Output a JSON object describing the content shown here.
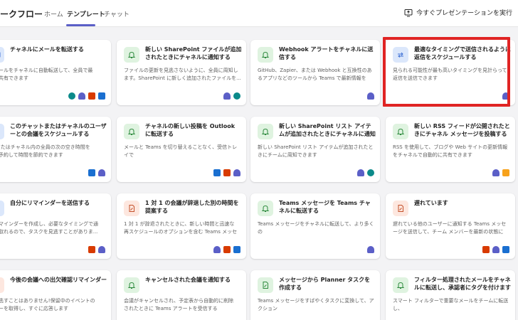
{
  "header": {
    "title": "ークフロー",
    "tabs": [
      {
        "label": "ホーム"
      },
      {
        "label": "テンプレート"
      },
      {
        "label": "チャット"
      }
    ],
    "present_label": "今すぐプレゼンテーションを実行"
  },
  "cards": [
    {
      "title": "チャネルにメールを転送する",
      "desc": "なメールをチャネルに自動転送して、全員で最\n報を共有できます"
    },
    {
      "title": "新しい SharePoint ファイルが追加されたときにチャネルに通知する",
      "desc": "ファイルの更新を見逃さないように、全員に周知し\nます。SharePoint に新しく追加されたファイルを..."
    },
    {
      "title": "Webhook アラートをチャネルに送信する",
      "desc": "GitHub、Zapier、または Webhook と互換性のあ\nるアプリなどのツールから Teams で最新情報を取..."
    },
    {
      "title": "最適なタイミングで送信されるように返信をスケジュールする",
      "desc": "見られる可能性が最も高いタイミングを見計らって\n返信を送信できます"
    },
    {
      "title": "このチャットまたはチャネルのユーザーとの会議をスケジュールする",
      "desc": "ま!またはチャネル内の全員の次の空き時間を\n的に予約して時間を節約できます"
    },
    {
      "title": "チャネルの新しい投稿を Outlook に転送する",
      "desc": "メールと Teams を切り替えることなく、受信トレイで\n重要なチャネル投稿を確認できます"
    },
    {
      "title": "新しい SharePoint リスト アイテムが追加されたときにチャネルに通知する",
      "desc": "新しい SharePoint リスト アイテムが追加されたと\nきにチームに周知できます"
    },
    {
      "title": "新しい RSS フィードが公開されたときにチャネル メッセージを投稿する",
      "desc": "RSS を使用して、ブログや Web サイトの更新情報\nをチャネルで自動的に共有できます"
    },
    {
      "title": "自分にリマインダーを送信する",
      "desc": "なリマインダーを作成し、必要なタイミングで通\n受け取れるので、タスクを見逃すことがありま..."
    },
    {
      "title": "1 対 1 の会議が辞退した別の時間を提案する",
      "desc": "1 対 1 が辞退されたときに、新しい時間と迅速な\n再スケジュールのオプションを含む Teams メッセー..."
    },
    {
      "title": "Teams メッセージを Teams チャネルに転送する",
      "desc": "Teams メッセージをチャネルに転送して、より多くの\nユーザーと共有します"
    },
    {
      "title": "遅れています",
      "desc": "遅れている他のユーザーに通知する Teams メッセ\nージを送信して、チーム メンバーを最新の状態に保..."
    },
    {
      "title": "今後の会議への出欠確認リマインダー",
      "desc": "を見逃すことはありません!保留中のイベントの\nンダーを取得し、すぐに応答します"
    },
    {
      "title": "キャンセルされた会議を通知する",
      "desc": "会議がキャンセルされ、予定表から自動的に削除\nされたときに Teams アラートを受信する"
    },
    {
      "title": "メッセージから Planner タスクを作成する",
      "desc": "Teams メッセージをすばやくタスクに変換して、アクション\nアイテムを常に把握できます"
    },
    {
      "title": "フィルター処理されたメールをチャネルに転送し、承認者にタグを付けます",
      "desc": "スマート フィルターで重要なメールをチームに転送し、\nチャネル送信で承認者をタグ付けできます"
    }
  ],
  "colors": {
    "accent": "#5b5fc7",
    "highlight": "#e02424",
    "icon_bg_green": "#dff3e0"
  }
}
